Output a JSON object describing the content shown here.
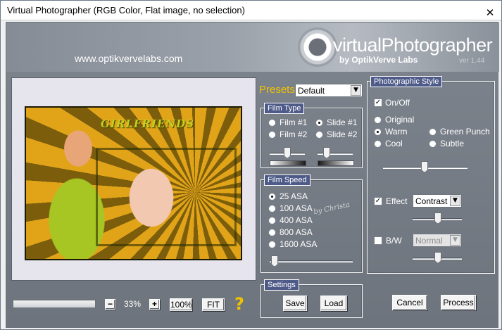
{
  "window": {
    "title": "Virtual Photographer (RGB Color, Flat image, no selection)",
    "close_glyph": "✕"
  },
  "banner": {
    "url": "www.optikvervelabs.com",
    "logo_name": "virtualPhotographer",
    "logo_sub": "by OptikVerve Labs",
    "version": "ver 1.44"
  },
  "preview": {
    "image_title": "GIRLFRIENDS"
  },
  "presets": {
    "label": "Presets",
    "value": "Default"
  },
  "film_type": {
    "title": "Film Type",
    "options": [
      "Film #1",
      "Slide #1",
      "Film #2",
      "Slide #2"
    ],
    "selected": "Slide #1"
  },
  "film_speed": {
    "title": "Film Speed",
    "options": [
      "25 ASA",
      "100 ASA",
      "400 ASA",
      "800 ASA",
      "1600 ASA"
    ],
    "selected": "25 ASA"
  },
  "settings": {
    "title": "Settings",
    "save": "Save",
    "load": "Load"
  },
  "photographic_style": {
    "title": "Photographic Style",
    "onoff_label": "On/Off",
    "onoff_checked": true,
    "styles": [
      "Original",
      "Warm",
      "Green Punch",
      "Cool",
      "Subtle"
    ],
    "selected": "Warm",
    "effect_label": "Effect",
    "effect_checked": true,
    "effect_value": "Contrast",
    "bw_label": "B/W",
    "bw_checked": false,
    "bw_value": "Normal"
  },
  "zoom": {
    "minus": "−",
    "value": "33%",
    "plus": "+",
    "hundred": "100%",
    "fit": "FIT",
    "help": "?"
  },
  "actions": {
    "cancel": "Cancel",
    "process": "Process"
  },
  "watermark": "by Christa",
  "icons": {
    "close": "close-icon",
    "help": "help-icon",
    "dropdown": "chevron-down-icon",
    "logo": "lens-logo-icon"
  },
  "colors": {
    "group_title_bg": "#4e5a88",
    "panel_bg": "#7c838c",
    "accent_presets": "#f2c200"
  }
}
